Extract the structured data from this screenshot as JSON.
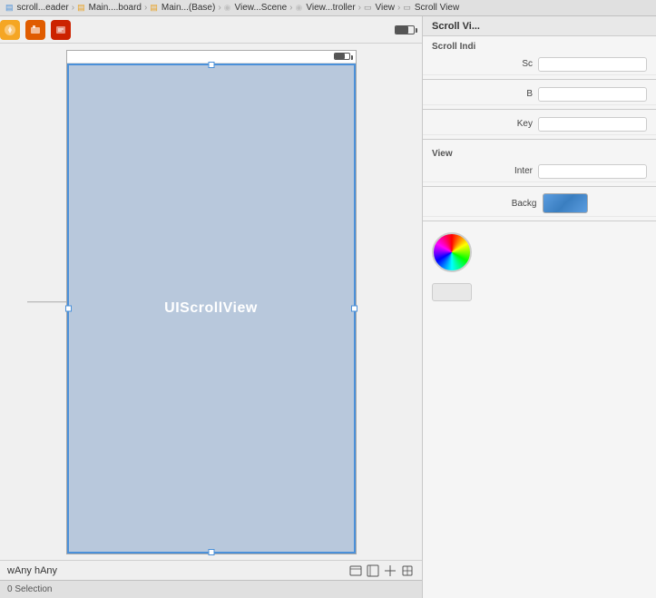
{
  "breadcrumb": {
    "items": [
      {
        "label": "scroll...eader",
        "type": "folder"
      },
      {
        "label": "Main....board",
        "type": "storyboard"
      },
      {
        "label": "Main...(Base)",
        "type": "storyboard"
      },
      {
        "label": "View...Scene",
        "type": "scene"
      },
      {
        "label": "View...troller",
        "type": "controller"
      },
      {
        "label": "View",
        "type": "view"
      },
      {
        "label": "Scroll View",
        "type": "view"
      }
    ],
    "separator": "›"
  },
  "toolbar": {
    "icons": [
      "yellow-icon",
      "orange-icon",
      "red-icon"
    ]
  },
  "canvas": {
    "arrow_label": "→",
    "scroll_view_label": "UIScrollView",
    "size_label": "wAny hAny"
  },
  "right_panel": {
    "title": "Scroll Vi...",
    "sections": [
      {
        "label": "Scroll Indi",
        "rows": [
          {
            "label": "Sc",
            "value": ""
          },
          {
            "label": "B",
            "value": ""
          }
        ]
      },
      {
        "label": "Key",
        "value": ""
      },
      {
        "label": "View",
        "rows": [
          {
            "label": "Inter",
            "value": ""
          },
          {
            "label": "Backg",
            "value": "color-swatch"
          }
        ]
      }
    ]
  },
  "status_footer": {
    "text": "0 Selection"
  }
}
